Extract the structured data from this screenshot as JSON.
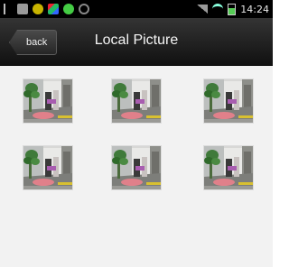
{
  "status_bar": {
    "time": "14:24",
    "icons_left": [
      "usb-icon",
      "document-icon",
      "notification-icon",
      "app-icon",
      "chat-icon",
      "sync-icon"
    ],
    "icons_right": [
      "signal-icon",
      "wifi-icon",
      "battery-icon"
    ]
  },
  "title_bar": {
    "back_label": "back",
    "title": "Local Picture"
  },
  "gallery": {
    "rows": 2,
    "columns": 3,
    "thumbnails": [
      {
        "alt": "room-with-plant"
      },
      {
        "alt": "room-with-plant"
      },
      {
        "alt": "room-with-plant"
      },
      {
        "alt": "room-with-plant"
      },
      {
        "alt": "room-with-plant"
      },
      {
        "alt": "room-with-plant"
      }
    ]
  }
}
